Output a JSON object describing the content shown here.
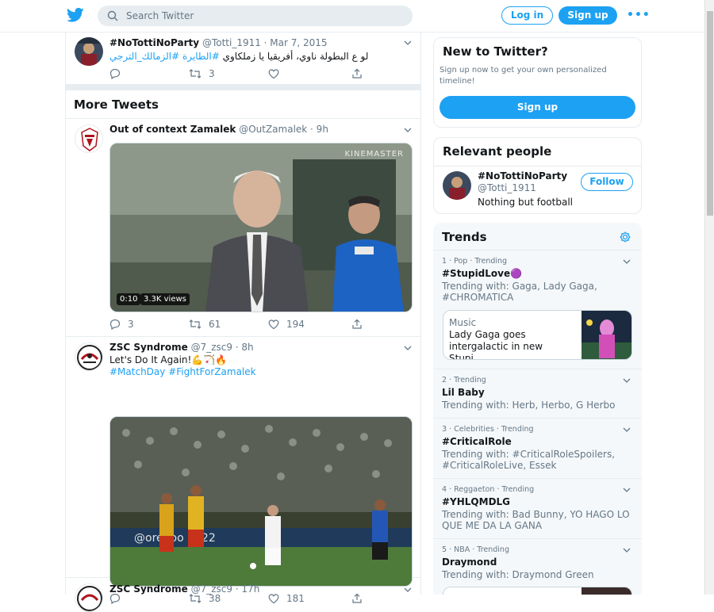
{
  "header": {
    "search_placeholder": "Search Twitter",
    "login_label": "Log in",
    "signup_label": "Sign up",
    "more_label": "•••",
    "brand_color": "#1da1f2"
  },
  "timeline": {
    "first_tweet": {
      "name": "#NoTottiNoParty",
      "handle": "@Totti_1911 · Mar 7, 2015",
      "text_plain": "لو ع البطولة ناوي، أفريقيا يا زملكاوي ",
      "tag1": "#الطايرة",
      "tag2": "#الزمالك_الترجي",
      "retweets": "3"
    },
    "more_tweets_title": "More Tweets",
    "tweets": [
      {
        "name": "Out of context Zamalek",
        "handle": "@OutZamalek · 9h",
        "video_time": "0:10",
        "video_views": "3.3K views",
        "watermark": "KINEMASTER",
        "replies": "3",
        "retweets": "61",
        "likes": "194"
      },
      {
        "name": "ZSC Syndrome",
        "handle": "@7_zsc9 · 8h",
        "text": "Let's Do It Again!💪🏹🔥",
        "tag1": "#MatchDay",
        "tag2": "#FightForZamalek",
        "ad_text": "@oredoo 2022",
        "replies": "",
        "retweets": "38",
        "likes": "181"
      },
      {
        "name": "ZSC Syndrome",
        "handle": "@7_zsc9 · 17h"
      }
    ]
  },
  "sidebar": {
    "new_to_twitter": {
      "title": "New to Twitter?",
      "desc": "Sign up now to get your own personalized timeline!",
      "button": "Sign up"
    },
    "relevant_people": {
      "title": "Relevant people",
      "name": "#NoTottiNoParty",
      "handle": "@Totti_1911",
      "bio": "Nothing but football",
      "follow": "Follow"
    },
    "trends": {
      "title": "Trends",
      "items": [
        {
          "meta": "1 · Pop · Trending",
          "name": "#StupidLove🟣",
          "with": "Trending with: Gaga, Lady Gaga, #CHROMATICA",
          "card_category": "Music",
          "card_text": "Lady Gaga goes intergalactic in new Stupi..."
        },
        {
          "meta": "2 · Trending",
          "name": "Lil Baby",
          "with": "Trending with: Herb, Herbo, G Herbo"
        },
        {
          "meta": "3 · Celebrities · Trending",
          "name": "#CriticalRole",
          "with": "Trending with: #CriticalRoleSpoilers, #CriticalRoleLive, Essek"
        },
        {
          "meta": "4 · Reggaeton · Trending",
          "name": "#YHLQMDLG",
          "with": "Trending with: Bad Bunny, YO HAGO LO QUE ME DA LA GANA"
        },
        {
          "meta": "5 · NBA · Trending",
          "name": "Draymond",
          "with": "Trending with: Draymond Green"
        }
      ]
    }
  }
}
